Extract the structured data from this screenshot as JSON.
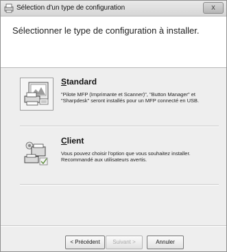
{
  "window": {
    "title": "Sélection d'un type de configuration",
    "close_label": "x"
  },
  "header": {
    "title": "Sélectionner le type de configuration à installer."
  },
  "options": [
    {
      "title_mnemonic": "S",
      "title_rest": "tandard",
      "description_line1": "\"Pilote MFP (Imprimante et Scanner)\", \"Button Manager\" et",
      "description_line2": "\"Sharpdesk\" seront installés pour un MFP connecté en USB."
    },
    {
      "title_mnemonic": "C",
      "title_rest": "lient",
      "description_line1": "Vous pouvez choisir l'option que vous souhaitez installer.",
      "description_line2": "Recommandé aux utilisateurs avertis."
    }
  ],
  "buttons": {
    "back_label": "< Précédent",
    "next_label": "Suivant >",
    "cancel_label": "Annuler"
  },
  "colors": {
    "window_bg": "#eeeeee",
    "header_bg": "#ffffff"
  }
}
